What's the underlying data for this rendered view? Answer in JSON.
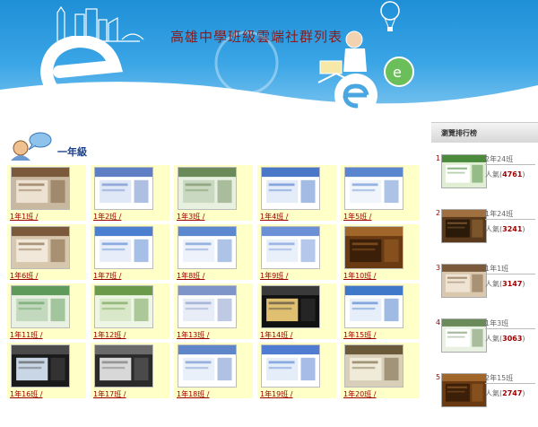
{
  "banner": {
    "title": "高雄中學班級雲端社群列表"
  },
  "grade": {
    "title": "一年級"
  },
  "classes": [
    {
      "label": "1年1班 /",
      "thumb_colors": [
        "#c9b8a0",
        "#7a5a3a",
        "#ede2d2"
      ]
    },
    {
      "label": "1年2班 /",
      "thumb_colors": [
        "#ffffff",
        "#5f7fc4",
        "#dfe8f7"
      ]
    },
    {
      "label": "1年3班 /",
      "thumb_colors": [
        "#e8f0e0",
        "#6a8a5a",
        "#c9d8c0"
      ]
    },
    {
      "label": "1年4班 /",
      "thumb_colors": [
        "#ffffff",
        "#4a78c8",
        "#e4ecf9"
      ]
    },
    {
      "label": "1年5班 /",
      "thumb_colors": [
        "#ffffff",
        "#5a86d0",
        "#f0f4fb"
      ]
    },
    {
      "label": "1年6班 /",
      "thumb_colors": [
        "#d7c7ad",
        "#7a5a3a",
        "#f1e8da"
      ]
    },
    {
      "label": "1年7班 /",
      "thumb_colors": [
        "#ffffff",
        "#4c7fd0",
        "#e8eef9"
      ]
    },
    {
      "label": "1年8班 /",
      "thumb_colors": [
        "#ffffff",
        "#5c88cf",
        "#eef2fa"
      ]
    },
    {
      "label": "1年9班 /",
      "thumb_colors": [
        "#ffffff",
        "#6b90d6",
        "#eaf0fa"
      ]
    },
    {
      "label": "1年10班 /",
      "thumb_colors": [
        "#6a3a12",
        "#a0662a",
        "#3b1f08"
      ]
    },
    {
      "label": "1年11班 /",
      "thumb_colors": [
        "#e9f1e3",
        "#5e9a5a",
        "#c2d9bd"
      ]
    },
    {
      "label": "1年12班 /",
      "thumb_colors": [
        "#eef6e6",
        "#6b9a4a",
        "#d8e8c8"
      ]
    },
    {
      "label": "1年13班 /",
      "thumb_colors": [
        "#ffffff",
        "#7d95c8",
        "#e8ecf6"
      ]
    },
    {
      "label": "1年14班 /",
      "thumb_colors": [
        "#111111",
        "#3a3a3a",
        "#e0c070"
      ]
    },
    {
      "label": "1年15班 /",
      "thumb_colors": [
        "#ffffff",
        "#3f77c9",
        "#e6eef9"
      ]
    },
    {
      "label": "1年16班 /",
      "thumb_colors": [
        "#1a1a1a",
        "#4a4a4a",
        "#c9d6e6"
      ]
    },
    {
      "label": "1年17班 /",
      "thumb_colors": [
        "#2a2a2a",
        "#6a6a6a",
        "#d8d8d8"
      ]
    },
    {
      "label": "1年18班 /",
      "thumb_colors": [
        "#ffffff",
        "#5f86c8",
        "#eaf0f9"
      ]
    },
    {
      "label": "1年19班 /",
      "thumb_colors": [
        "#ffffff",
        "#4f7cd0",
        "#e5edf9"
      ]
    },
    {
      "label": "1年20班 /",
      "thumb_colors": [
        "#d9cfb8",
        "#6a5a3a",
        "#f0ead8"
      ]
    }
  ],
  "sidebar": {
    "title": "瀏覽排行榜",
    "items": [
      {
        "rank": "1",
        "name": "2年24班",
        "pop_label": "人氣(",
        "pop_value": "4761",
        "pop_close": ")",
        "thumb_colors": [
          "#e0eed4",
          "#4a8a3a",
          "#ffffff"
        ]
      },
      {
        "rank": "2",
        "name": "1年24班",
        "pop_label": "人氣(",
        "pop_value": "3241",
        "pop_close": ")",
        "thumb_colors": [
          "#5a3a1a",
          "#a07040",
          "#2a1a0a"
        ]
      },
      {
        "rank": "3",
        "name": "1年1班",
        "pop_label": "人氣(",
        "pop_value": "3147",
        "pop_close": ")",
        "thumb_colors": [
          "#d9c8ae",
          "#7a5a3a",
          "#efe4d4"
        ]
      },
      {
        "rank": "4",
        "name": "1年3班",
        "pop_label": "人氣(",
        "pop_value": "3063",
        "pop_close": ")",
        "thumb_colors": [
          "#e9f1e3",
          "#6a8a5a",
          "#ffffff"
        ]
      },
      {
        "rank": "5",
        "name": "2年15班",
        "pop_label": "人氣(",
        "pop_value": "2747",
        "pop_close": ")",
        "thumb_colors": [
          "#6a3a12",
          "#a0662a",
          "#3b1f08"
        ]
      }
    ]
  }
}
